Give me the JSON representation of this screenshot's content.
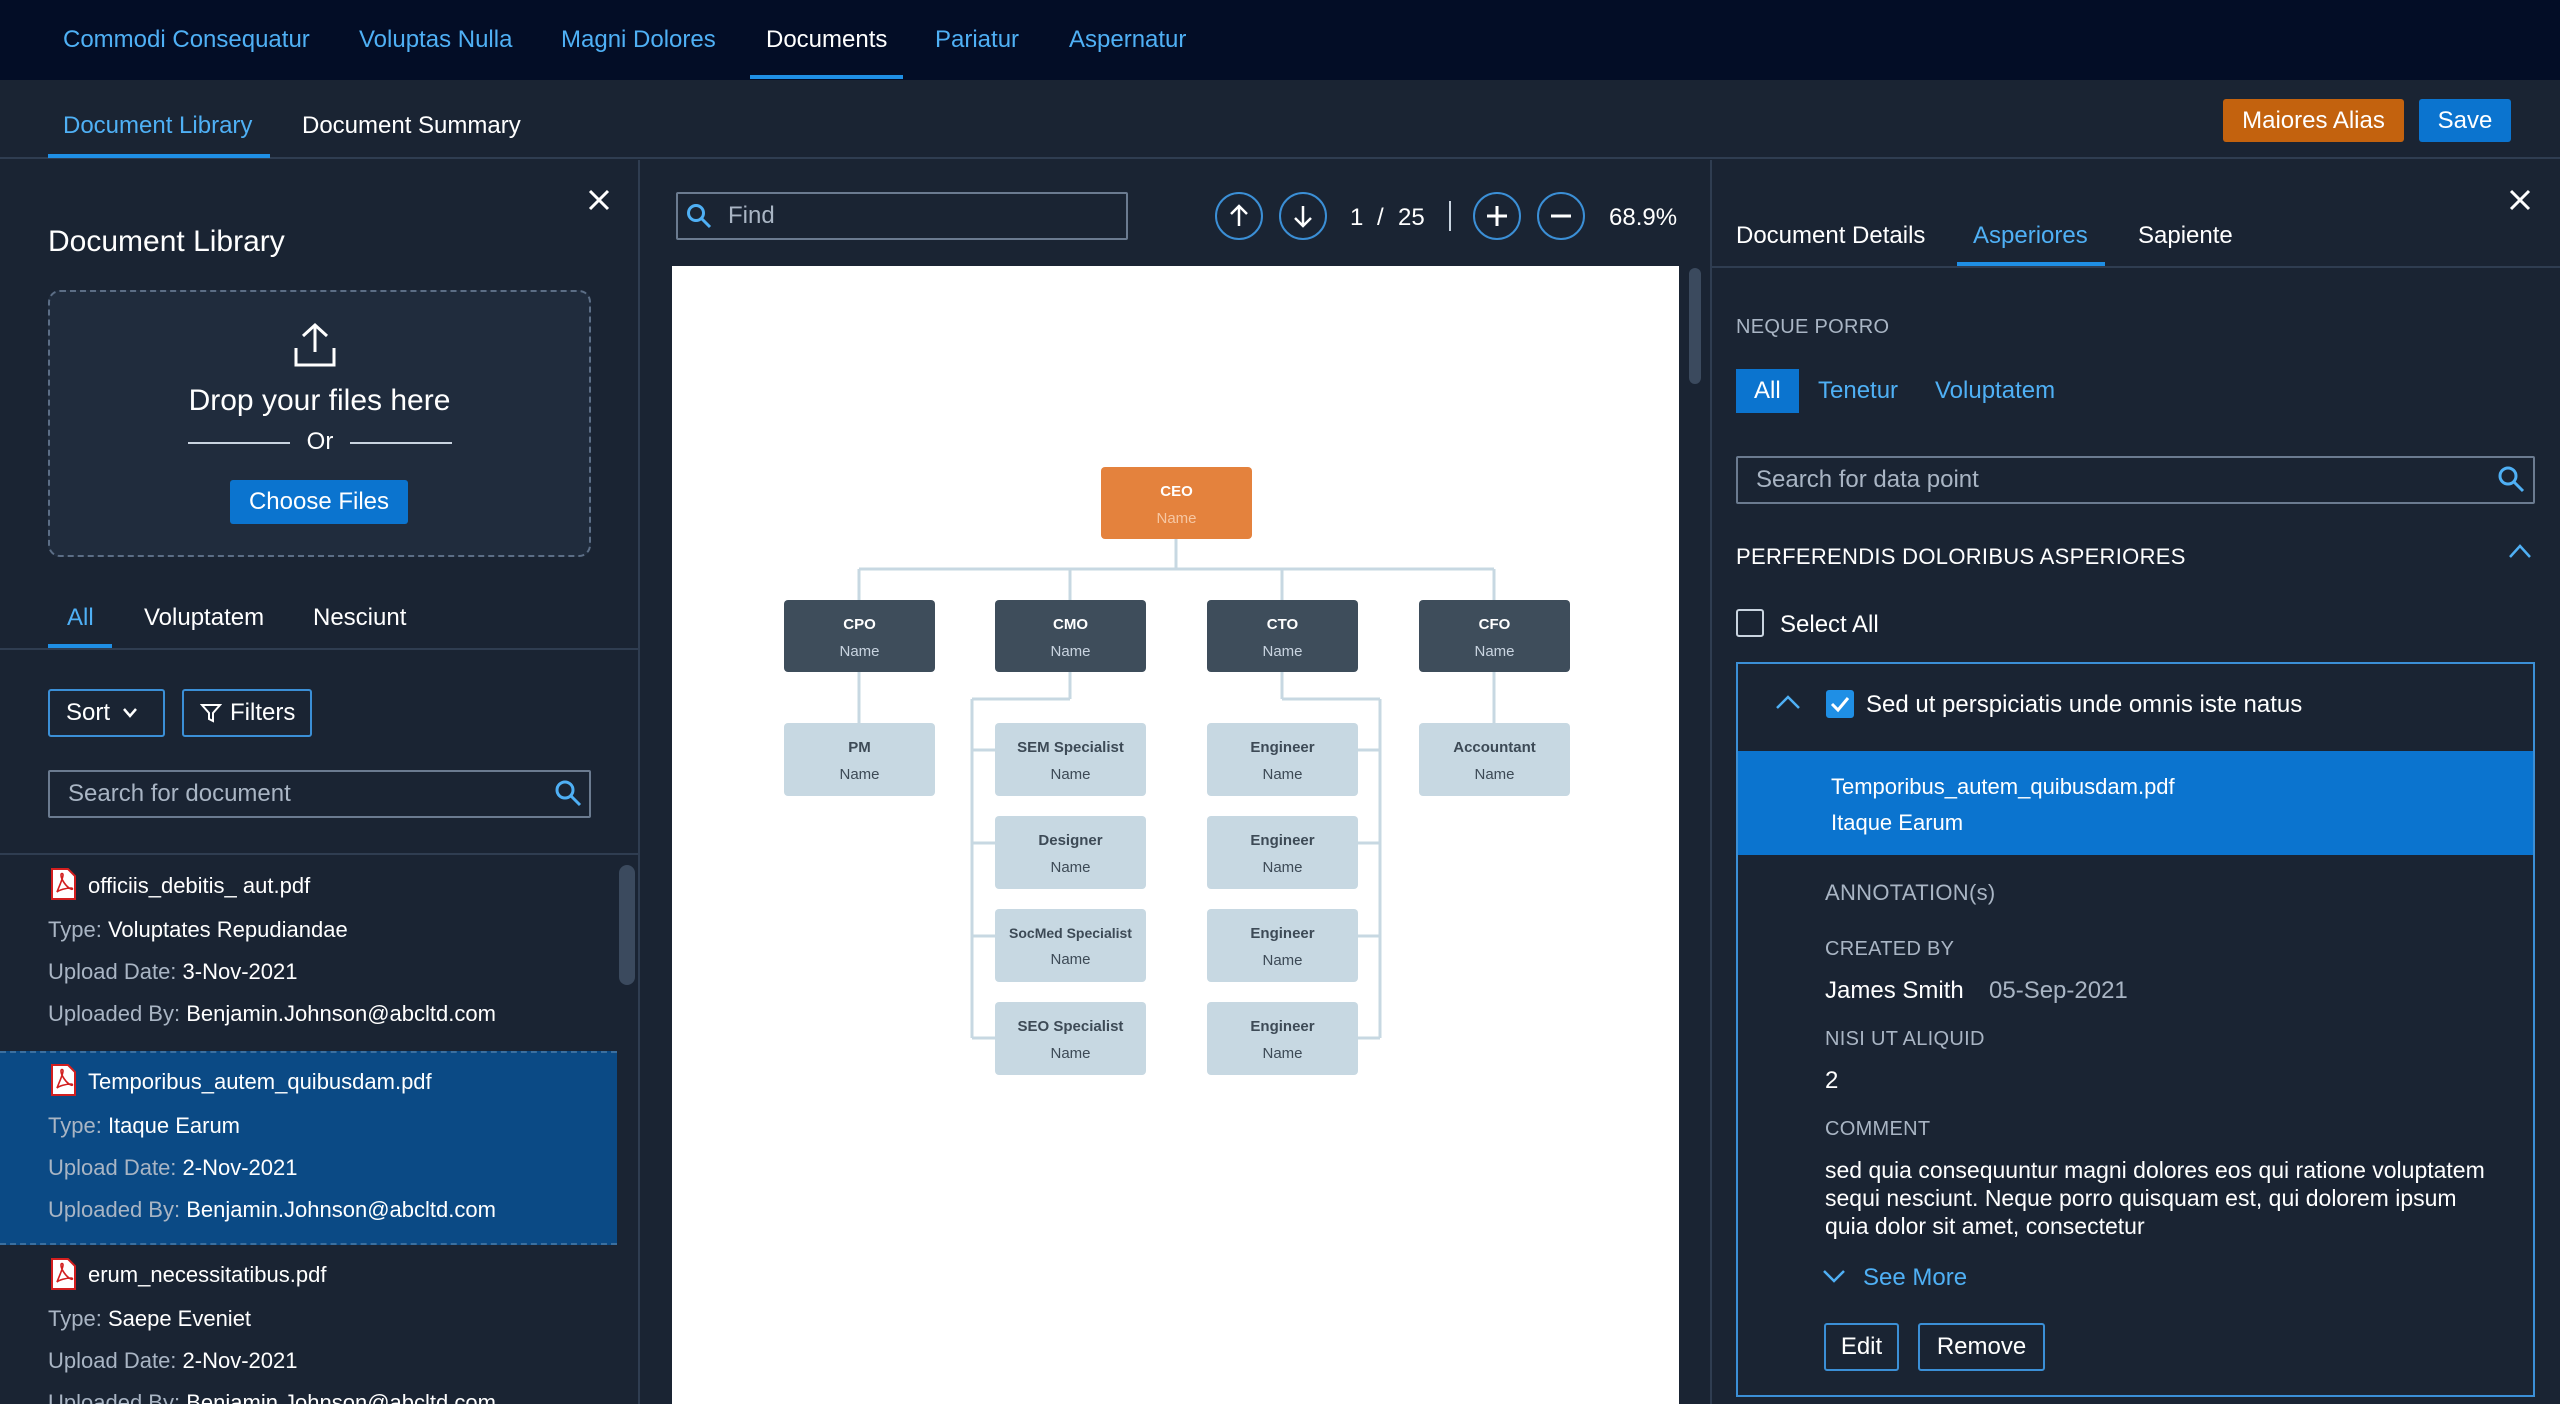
{
  "top_nav": {
    "items": [
      "Commodi Consequatur",
      "Voluptas Nulla",
      "Magni Dolores",
      "Documents",
      "Pariatur",
      "Aspernatur"
    ],
    "active": "Documents"
  },
  "sub_nav": {
    "tabs": [
      "Document Library",
      "Document Summary"
    ],
    "active": "Document Library",
    "action_label": "Maiores Alias",
    "save_label": "Save"
  },
  "library": {
    "title": "Document Library",
    "drop_text": "Drop your files here",
    "or_text": "Or",
    "choose_label": "Choose Files",
    "tabs": [
      "All",
      "Voluptatem",
      "Nesciunt"
    ],
    "active_tab": "All",
    "sort_label": "Sort",
    "filters_label": "Filters",
    "search_placeholder": "Search for document",
    "type_label": "Type:",
    "upload_label": "Upload Date:",
    "by_label": "Uploaded By:",
    "documents": [
      {
        "name": "officiis_debitis_ aut.pdf",
        "type": "Voluptates Repudiandae",
        "date": "3-Nov-2021",
        "by": "Benjamin.Johnson@abcltd.com"
      },
      {
        "name": "Temporibus_autem_quibusdam.pdf",
        "type": "Itaque Earum",
        "date": "2-Nov-2021",
        "by": "Benjamin.Johnson@abcltd.com"
      },
      {
        "name": "erum_necessitatibus.pdf",
        "type": "Saepe Eveniet",
        "date": "2-Nov-2021",
        "by": "Benjamin.Johnson@abcltd.com"
      }
    ]
  },
  "viewer": {
    "find_placeholder": "Find",
    "page_current": "1",
    "page_sep": "/",
    "page_total": "25",
    "zoom": "68.9%",
    "org_chart": {
      "name_label": "Name",
      "root": "CEO",
      "level1": [
        "CPO",
        "CMO",
        "CTO",
        "CFO"
      ],
      "cpo_reports": [
        "PM"
      ],
      "cmo_reports": [
        "SEM Specialist",
        "Designer",
        "SocMed Specialist",
        "SEO Specialist"
      ],
      "cto_reports": [
        "Engineer",
        "Engineer",
        "Engineer",
        "Engineer"
      ],
      "cfo_reports": [
        "Accountant"
      ]
    }
  },
  "details": {
    "tabs": [
      "Document Details",
      "Asperiores",
      "Sapiente"
    ],
    "active_tab": "Asperiores",
    "section_caption": "NEQUE PORRO",
    "filters": [
      "All",
      "Tenetur",
      "Voluptatem"
    ],
    "active_filter": "All",
    "search_placeholder": "Search for data point",
    "group_title": "PERFERENDIS DOLORIBUS ASPERIORES",
    "select_all": "Select All",
    "card": {
      "title": "Sed ut perspiciatis unde omnis iste natus",
      "file": "Temporibus_autem_quibusdam.pdf",
      "file_type": "Itaque Earum",
      "annotations_caption": "ANNOTATION(s)",
      "created_caption": "CREATED BY",
      "created_by": "James Smith",
      "created_date": "05-Sep-2021",
      "nisi_caption": "NISI UT ALIQUID",
      "nisi_value": "2",
      "comment_caption": "COMMENT",
      "comment_lines": [
        "sed quia consequuntur magni dolores eos qui ratione voluptatem",
        "sequi nesciunt. Neque porro quisquam est, qui dolorem ipsum",
        "quia dolor sit amet, consectetur"
      ],
      "see_more": "See More",
      "edit_label": "Edit",
      "remove_label": "Remove"
    }
  },
  "colors": {
    "topbar": "#030d26",
    "panel": "#1a2433",
    "accent": "#0b74cf",
    "link": "#4fb0f5",
    "orange": "#c3620e",
    "selection": "#0b4a85"
  }
}
